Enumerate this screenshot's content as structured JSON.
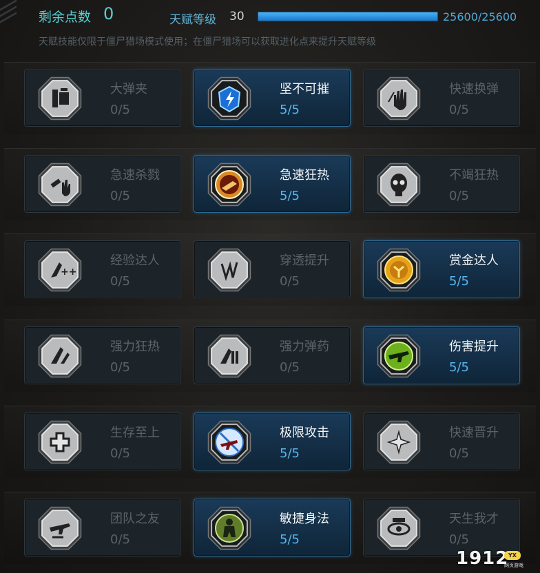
{
  "header": {
    "remaining_points_label": "剩余点数",
    "remaining_points_value": "0",
    "talent_level_label": "天赋等级",
    "talent_level_value": "30",
    "xp_text": "25600/25600",
    "xp_progress": 1.0,
    "hint": "天赋技能仅限于僵尸猎场模式使用；在僵尸猎场可以获取进化点来提升天赋等级"
  },
  "colors": {
    "accent_cyan": "#56cfd0",
    "accent_blue": "#4fa9da",
    "active_level_blue": "#58b7f0"
  },
  "talents": [
    [
      {
        "name": "大弹夹",
        "level": "0/5",
        "active": false,
        "icon": "magazine-icon"
      },
      {
        "name": "坚不可摧",
        "level": "5/5",
        "active": true,
        "icon": "shield-lightning-icon"
      },
      {
        "name": "快速换弹",
        "level": "0/5",
        "active": false,
        "icon": "hand-reload-icon"
      }
    ],
    [
      {
        "name": "急速杀戮",
        "level": "0/5",
        "active": false,
        "icon": "rapid-kill-icon"
      },
      {
        "name": "急速狂热",
        "level": "5/5",
        "active": true,
        "icon": "frenzy-icon"
      },
      {
        "name": "不竭狂热",
        "level": "0/5",
        "active": false,
        "icon": "skull-icon"
      }
    ],
    [
      {
        "name": "经验达人",
        "level": "0/5",
        "active": false,
        "icon": "exp-plus-icon"
      },
      {
        "name": "穿透提升",
        "level": "0/5",
        "active": false,
        "icon": "penetration-icon"
      },
      {
        "name": "赏金达人",
        "level": "5/5",
        "active": true,
        "icon": "gold-coin-icon"
      }
    ],
    [
      {
        "name": "强力狂热",
        "level": "0/5",
        "active": false,
        "icon": "power-frenzy-icon"
      },
      {
        "name": "强力弹药",
        "level": "0/5",
        "active": false,
        "icon": "power-ammo-icon"
      },
      {
        "name": "伤害提升",
        "level": "5/5",
        "active": true,
        "icon": "rifle-icon"
      }
    ],
    [
      {
        "name": "生存至上",
        "level": "0/5",
        "active": false,
        "icon": "medical-cross-icon"
      },
      {
        "name": "极限攻击",
        "level": "5/5",
        "active": true,
        "icon": "extreme-attack-icon"
      },
      {
        "name": "快速晋升",
        "level": "0/5",
        "active": false,
        "icon": "star-burst-icon"
      }
    ],
    [
      {
        "name": "团队之友",
        "level": "0/5",
        "active": false,
        "icon": "team-rifle-icon"
      },
      {
        "name": "敏捷身法",
        "level": "5/5",
        "active": true,
        "icon": "soldier-icon"
      },
      {
        "name": "天生我才",
        "level": "0/5",
        "active": false,
        "icon": "eye-icon"
      }
    ]
  ],
  "watermark": {
    "text": "1912",
    "badge": "YX",
    "sub": "网页游戏"
  }
}
